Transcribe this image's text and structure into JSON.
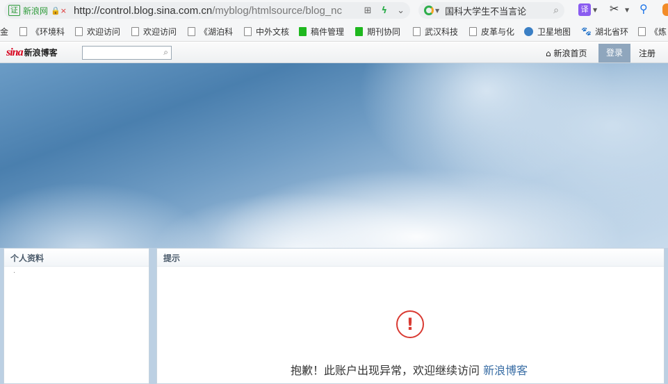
{
  "browser": {
    "cert_label": "证",
    "cert_site": "新浪网",
    "lock_mark": "🔒×",
    "url_main": "http://control.blog.sina.com.cn",
    "url_rest": "/myblog/htmlsource/blog_nc",
    "search_query": "国科大学生不当言论",
    "ext_translate": "译"
  },
  "bookmarks": [
    {
      "label": "金",
      "icon": "none"
    },
    {
      "label": "《环境科",
      "icon": "page"
    },
    {
      "label": "欢迎访问",
      "icon": "page"
    },
    {
      "label": "欢迎访问",
      "icon": "page"
    },
    {
      "label": "《湖泊科",
      "icon": "page"
    },
    {
      "label": "中外文核",
      "icon": "page"
    },
    {
      "label": "稿件管理",
      "icon": "green"
    },
    {
      "label": "期刊协同",
      "icon": "green"
    },
    {
      "label": "武汉科技",
      "icon": "page"
    },
    {
      "label": "皮革与化",
      "icon": "page"
    },
    {
      "label": "卫星地图",
      "icon": "globe"
    },
    {
      "label": "湖北省环",
      "icon": "paw"
    },
    {
      "label": "《炼",
      "icon": "page"
    }
  ],
  "sina": {
    "logo_main": "sina",
    "logo_sub": "新浪博客",
    "search_value": "",
    "nav_home": "新浪首页",
    "nav_login": "登录",
    "nav_register": "注册"
  },
  "panels": {
    "left_title": "个人资料",
    "left_dot": "·",
    "main_title": "提示",
    "alert_symbol": "!",
    "message": "抱歉！此账户出现异常，欢迎继续访问",
    "message_link": "新浪博客"
  }
}
